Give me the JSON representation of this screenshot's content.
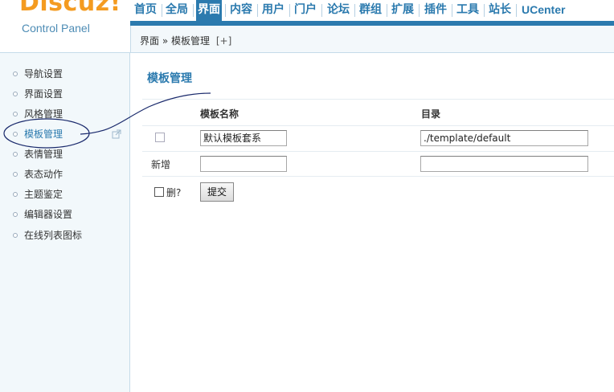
{
  "brand": {
    "logo": "Discuz!",
    "subtitle": "Control Panel"
  },
  "topnav": {
    "items": [
      "首页",
      "全局",
      "界面",
      "内容",
      "用户",
      "门户",
      "论坛",
      "群组",
      "扩展",
      "插件",
      "工具",
      "站长",
      "UCenter"
    ],
    "active": "界面"
  },
  "breadcrumb": {
    "section": "界面",
    "separator": "»",
    "current": "模板管理",
    "add": "[+]"
  },
  "sidebar": {
    "items": [
      "导航设置",
      "界面设置",
      "风格管理",
      "模板管理",
      "表情管理",
      "表态动作",
      "主题鉴定",
      "编辑器设置",
      "在线列表图标"
    ],
    "current": "模板管理"
  },
  "main": {
    "title": "模板管理",
    "columns": {
      "name": "模板名称",
      "dir": "目录"
    },
    "rows": [
      {
        "name": "默认模板套系",
        "dir": "./template/default"
      }
    ],
    "new_label": "新增",
    "new_name": "",
    "new_dir": "",
    "delete_label": "删?",
    "submit_label": "提交"
  },
  "colors": {
    "accent": "#2b7aae",
    "logo": "#f49b20",
    "sidebar_bg": "#f2f8fb"
  }
}
